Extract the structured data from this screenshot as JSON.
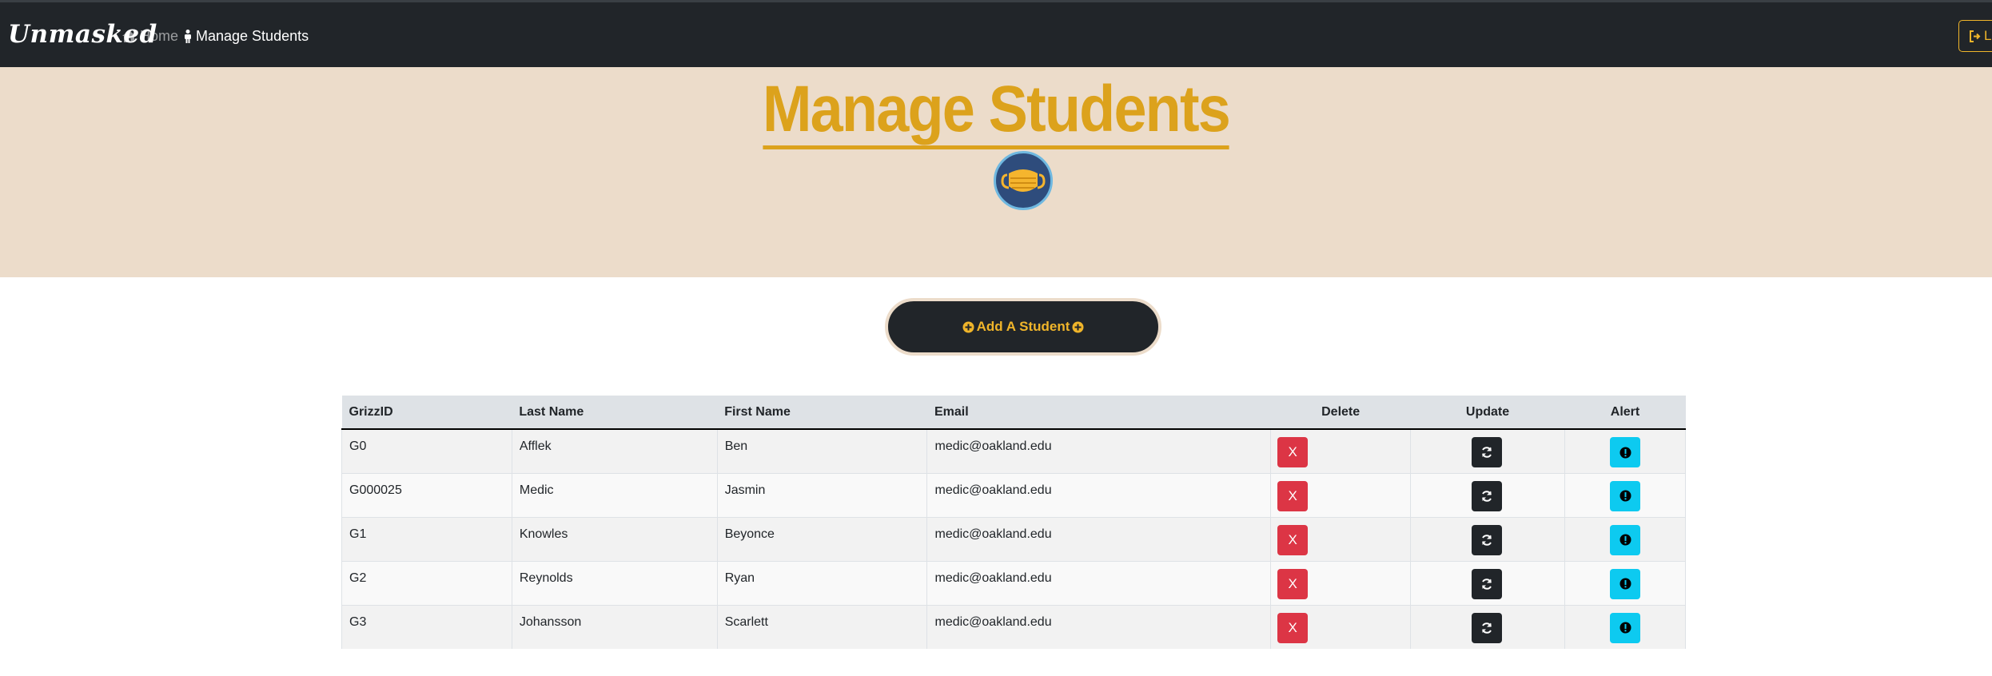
{
  "nav": {
    "brand": "Unmasked",
    "home_label": "Home",
    "manage_label": "Manage Students",
    "logout_label": "Lo"
  },
  "hero": {
    "title": "Manage Students",
    "icon": "face-mask-icon"
  },
  "add_button": {
    "label": "Add A Student"
  },
  "table": {
    "headers": [
      "GrizzID",
      "Last Name",
      "First Name",
      "Email",
      "Delete",
      "Update",
      "Alert"
    ],
    "delete_label": "X",
    "rows": [
      {
        "id": "G0",
        "last": "Afflek",
        "first": "Ben",
        "email": "medic@oakland.edu"
      },
      {
        "id": "G000025",
        "last": "Medic",
        "first": "Jasmin",
        "email": "medic@oakland.edu"
      },
      {
        "id": "G1",
        "last": "Knowles",
        "first": "Beyonce",
        "email": "medic@oakland.edu"
      },
      {
        "id": "G2",
        "last": "Reynolds",
        "first": "Ryan",
        "email": "medic@oakland.edu"
      },
      {
        "id": "G3",
        "last": "Johansson",
        "first": "Scarlett",
        "email": "medic@oakland.edu"
      }
    ]
  },
  "colors": {
    "navbar": "#212529",
    "accent": "#dca21c",
    "hero_bg": "#ecdcca",
    "delete": "#dc3545",
    "alert": "#0dcaf0"
  }
}
